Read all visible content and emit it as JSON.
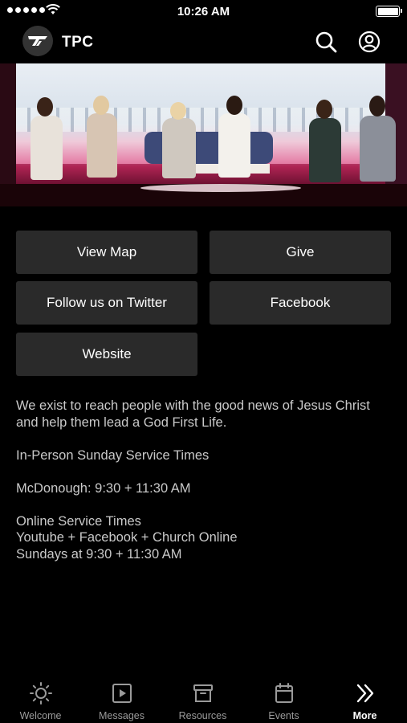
{
  "status_bar": {
    "time": "10:26 AM"
  },
  "header": {
    "title": "TPC",
    "logo_icon": "tpc-logo-icon",
    "search_icon": "search-icon",
    "profile_icon": "account-circle-icon"
  },
  "hero": {
    "image": "women-panel-stage-photo"
  },
  "buttons": {
    "view_map": "View Map",
    "give": "Give",
    "twitter": "Follow us on Twitter",
    "facebook": "Facebook",
    "website": "Website"
  },
  "description": {
    "mission": "We exist to reach people with the good news of Jesus Christ and help them lead a God First Life.",
    "service_heading": "In-Person Sunday Service Times",
    "mcdonough": "McDonough: 9:30 + 11:30 AM",
    "online_heading": "Online Service Times",
    "online_platforms": "Youtube + Facebook + Church Online",
    "online_times": "Sundays at 9:30 + 11:30 AM"
  },
  "tabs": [
    {
      "label": "Welcome",
      "icon": "sun-icon",
      "active": false
    },
    {
      "label": "Messages",
      "icon": "play-icon",
      "active": false
    },
    {
      "label": "Resources",
      "icon": "archive-icon",
      "active": false
    },
    {
      "label": "Events",
      "icon": "calendar-icon",
      "active": false
    },
    {
      "label": "More",
      "icon": "double-chevron-right-icon",
      "active": true
    }
  ]
}
